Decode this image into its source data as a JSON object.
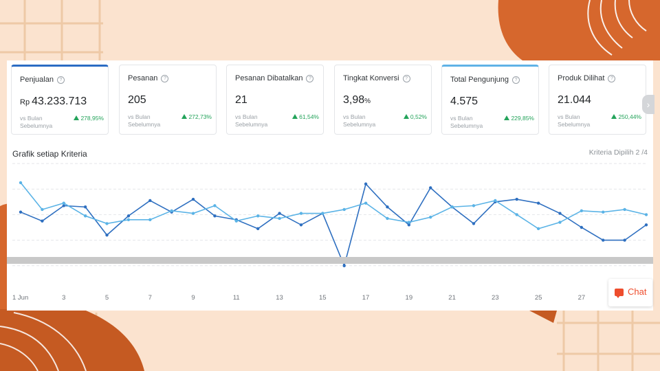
{
  "metrics": [
    {
      "title": "Penjualan",
      "prefix": "Rp",
      "value": "43.233.713",
      "suffix": "",
      "compare": "vs Bulan Sebelumnya",
      "delta": "278,95%"
    },
    {
      "title": "Pesanan",
      "prefix": "",
      "value": "205",
      "suffix": "",
      "compare": "vs Bulan Sebelumnya",
      "delta": "272,73%"
    },
    {
      "title": "Pesanan Dibatalkan",
      "prefix": "",
      "value": "21",
      "suffix": "",
      "compare": "vs Bulan Sebelumnya",
      "delta": "61,54%"
    },
    {
      "title": "Tingkat Konversi",
      "prefix": "",
      "value": "3,98",
      "suffix": "%",
      "compare": "vs Bulan Sebelumnya",
      "delta": "0,52%"
    },
    {
      "title": "Total Pengunjung",
      "prefix": "",
      "value": "4.575",
      "suffix": "",
      "compare": "vs Bulan Sebelumnya",
      "delta": "229,85%"
    },
    {
      "title": "Produk Dilihat",
      "prefix": "",
      "value": "21.044",
      "suffix": "",
      "compare": "vs Bulan Sebelumnya",
      "delta": "250,44%"
    }
  ],
  "chart_section": {
    "title": "Grafik setiap Kriteria",
    "criteria": "Kriteria Dipilih 2 /4"
  },
  "chat": {
    "label": "Chat"
  },
  "chart_data": {
    "type": "line",
    "x": [
      1,
      2,
      3,
      4,
      5,
      6,
      7,
      8,
      9,
      10,
      11,
      12,
      13,
      14,
      15,
      16,
      17,
      18,
      19,
      20,
      21,
      22,
      23,
      24,
      25,
      26,
      27,
      28,
      29,
      30
    ],
    "tick_labels": [
      "1 Jun",
      "3",
      "5",
      "7",
      "9",
      "11",
      "13",
      "15",
      "17",
      "19",
      "21",
      "23",
      "25",
      "27"
    ],
    "xlim": [
      1,
      30
    ],
    "ylim": [
      0,
      100
    ],
    "series": [
      {
        "color": "#2e6fc0",
        "values": [
          62,
          55,
          67,
          66,
          44,
          59,
          71,
          62,
          72,
          59,
          56,
          49,
          61,
          52,
          61,
          20,
          84,
          66,
          52,
          81,
          66,
          53,
          70,
          72,
          69,
          61,
          50,
          40,
          40,
          52
        ]
      },
      {
        "color": "#5ab3e6",
        "values": [
          85,
          64,
          69,
          59,
          53,
          56,
          56,
          63,
          61,
          67,
          55,
          59,
          57,
          61,
          61,
          64,
          69,
          57,
          54,
          58,
          66,
          67,
          71,
          60,
          49,
          54,
          63,
          62,
          64,
          60
        ]
      }
    ]
  }
}
